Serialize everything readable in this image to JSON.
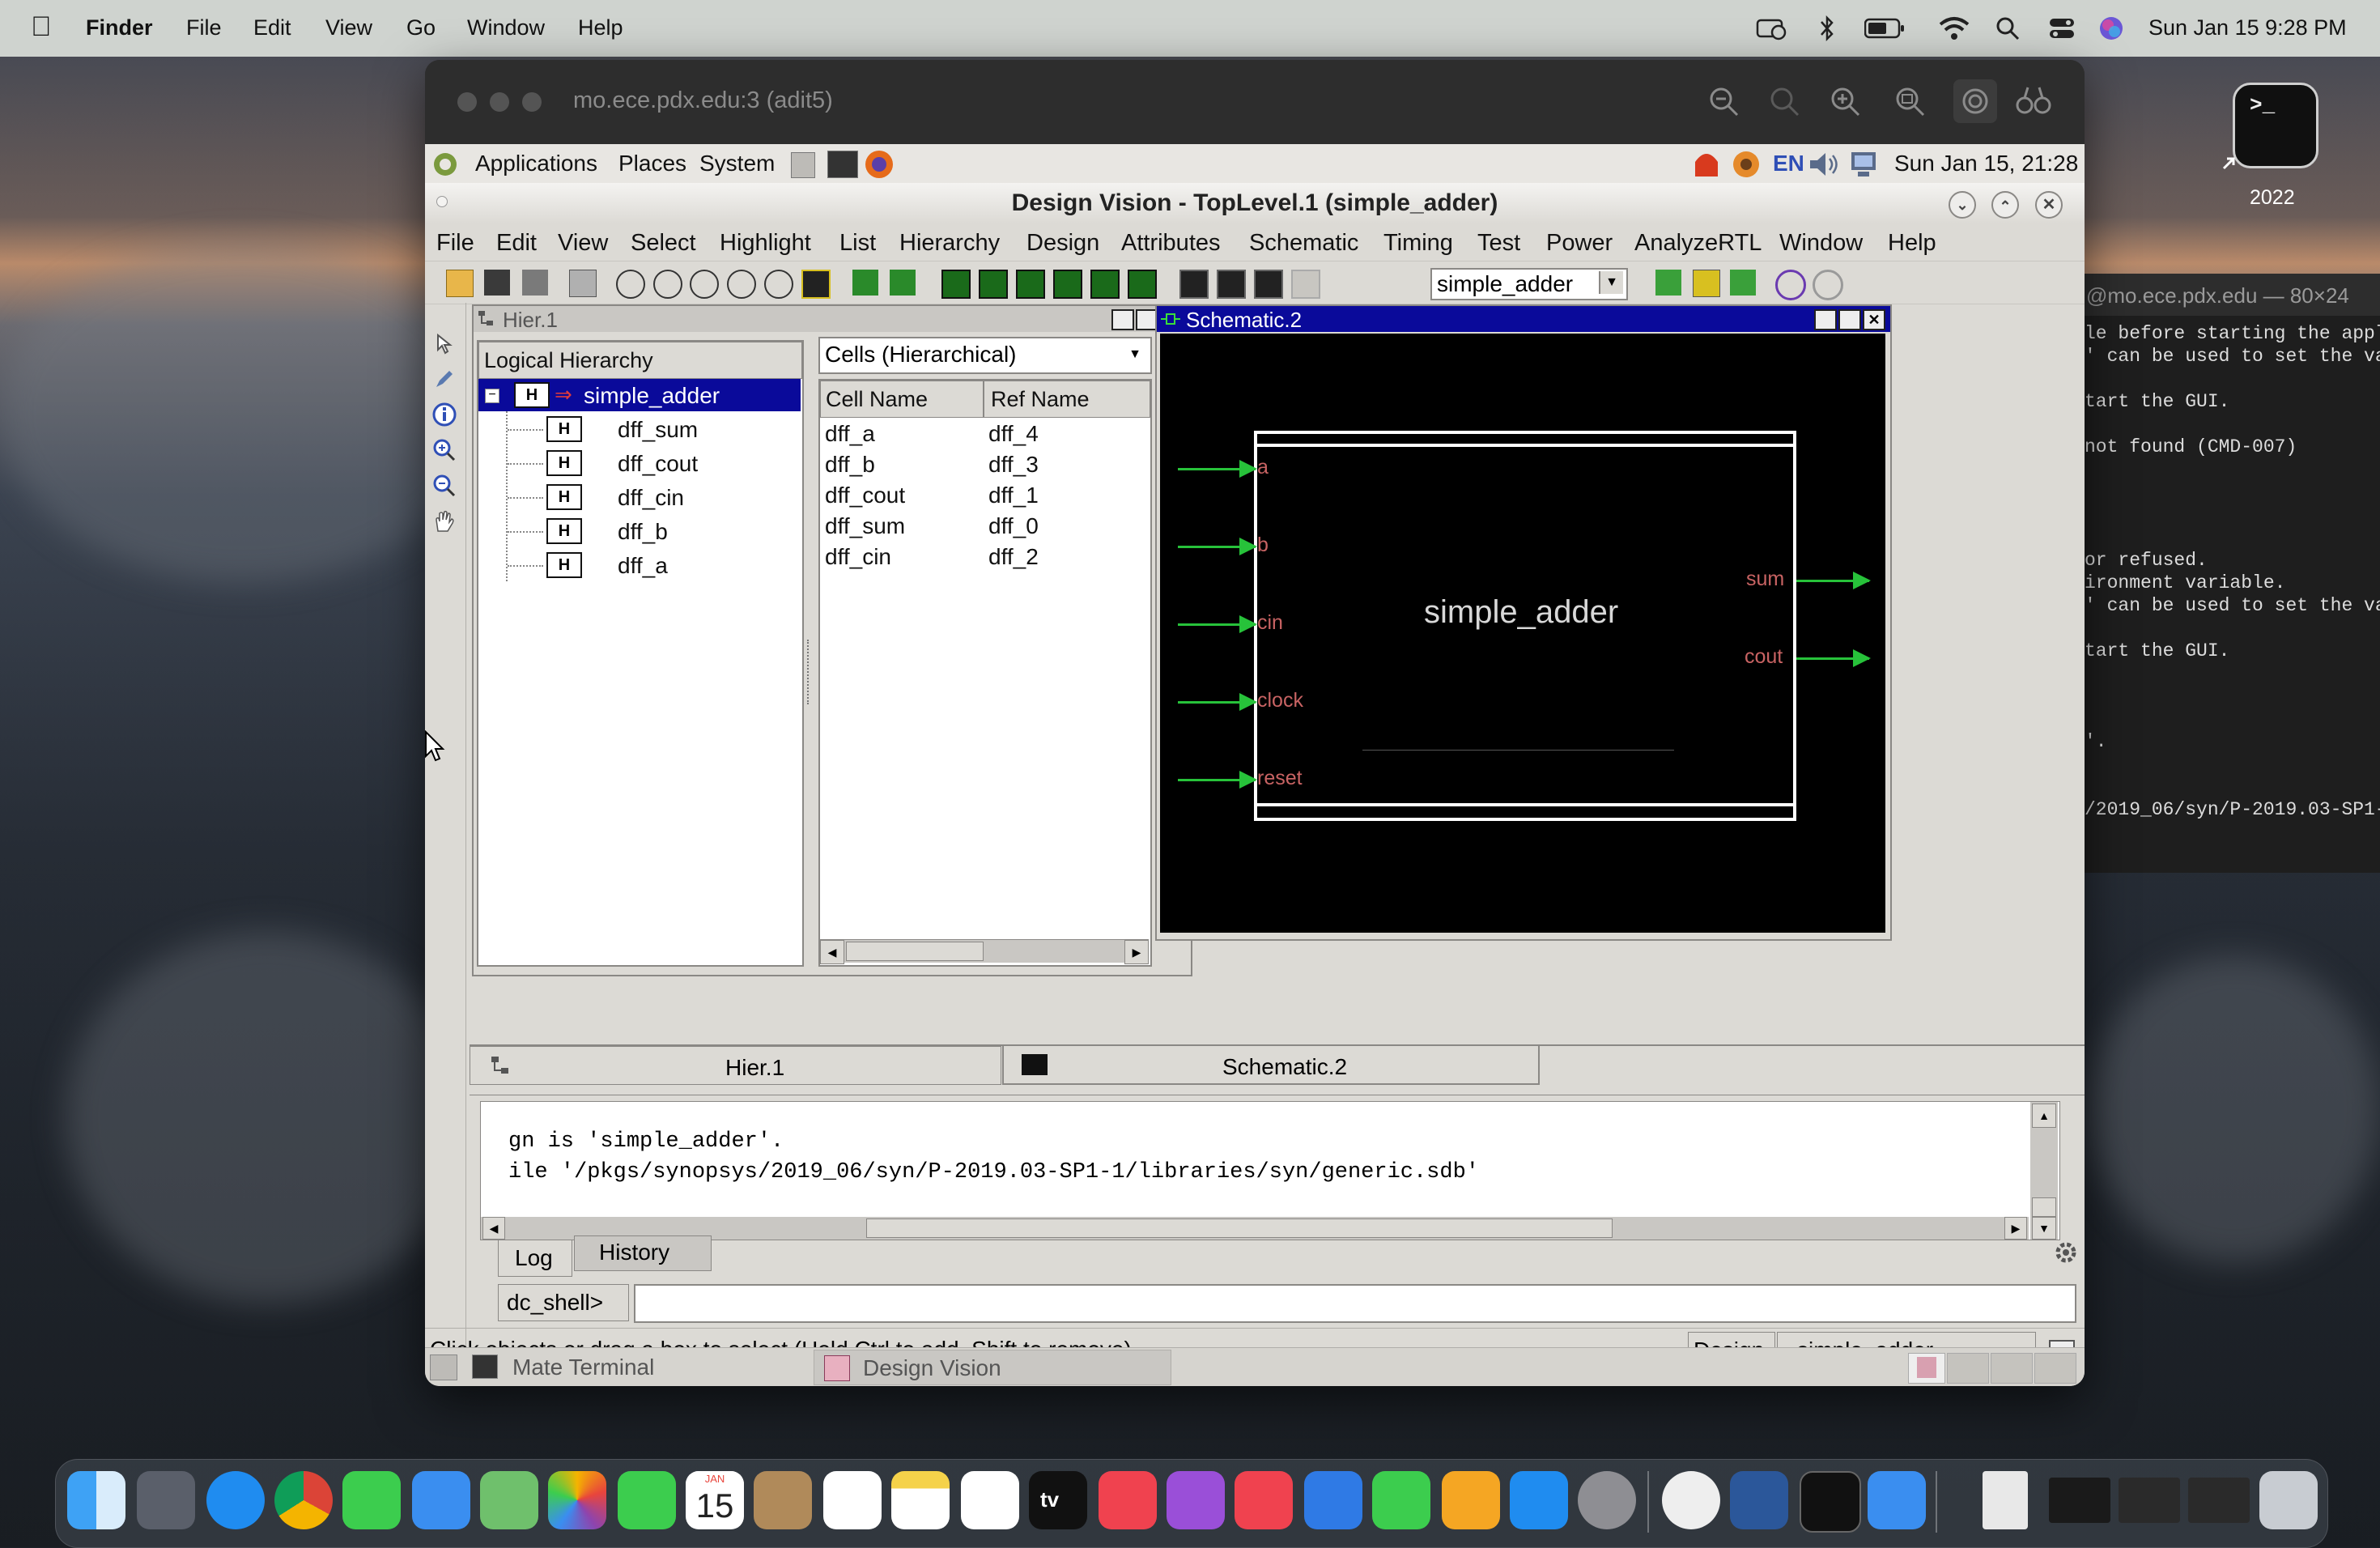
{
  "macos_menubar": {
    "app": "Finder",
    "menus": [
      "File",
      "Edit",
      "View",
      "Go",
      "Window",
      "Help"
    ],
    "clock": "Sun Jan 15  9:28 PM"
  },
  "desktop": {
    "terminal_icon_label": "2022",
    "terminal_prompt": ">_"
  },
  "remote_window": {
    "title": "mo.ece.pdx.edu:3 (adit5)"
  },
  "gnome_panel": {
    "menus": [
      "Applications",
      "Places",
      "System"
    ],
    "language": "EN",
    "clock": "Sun Jan 15, 21:28"
  },
  "design_vision": {
    "title": "Design Vision - TopLevel.1 (simple_adder)",
    "menus": [
      "File",
      "Edit",
      "View",
      "Select",
      "Highlight",
      "List",
      "Hierarchy",
      "Design",
      "Attributes",
      "Schematic",
      "Timing",
      "Test",
      "Power",
      "AnalyzeRTL",
      "Window",
      "Help"
    ],
    "design_select": "simple_adder",
    "hier_window": {
      "title": "Hier.1",
      "tree_header": "Logical Hierarchy",
      "root": "simple_adder",
      "children": [
        "dff_sum",
        "dff_cout",
        "dff_cin",
        "dff_b",
        "dff_a"
      ],
      "cells_dropdown": "Cells (Hierarchical)",
      "columns": [
        "Cell Name",
        "Ref Name"
      ],
      "rows": [
        [
          "dff_a",
          "dff_4"
        ],
        [
          "dff_b",
          "dff_3"
        ],
        [
          "dff_cout",
          "dff_1"
        ],
        [
          "dff_sum",
          "dff_0"
        ],
        [
          "dff_cin",
          "dff_2"
        ]
      ]
    },
    "schematic_window": {
      "title": "Schematic.2",
      "block_name": "simple_adder",
      "inputs": [
        "a",
        "b",
        "cin",
        "clock",
        "reset"
      ],
      "outputs": [
        "sum",
        "cout"
      ]
    },
    "bottom_tabs": [
      "Hier.1",
      "Schematic.2"
    ],
    "log_lines": [
      "gn is 'simple_adder'.",
      "ile '/pkgs/synopsys/2019_06/syn/P-2019.03-SP1-1/libraries/syn/generic.sdb'"
    ],
    "console_tabs": [
      "Log",
      "History"
    ],
    "prompt": "dc_shell>",
    "status_text": "Click objects or drag a box to select (Hold Ctrl to add, Shift to remove)",
    "status_design_label": "Design",
    "status_design_value": "simple_adder"
  },
  "gnome_taskbar": [
    "Mate Terminal",
    "Design Vision"
  ],
  "terminal_sliver": {
    "title": "@mo.ece.pdx.edu — 80×24",
    "lines": [
      "le before starting the appl",
      "' can be used to set the va",
      "",
      "tart the GUI.",
      "",
      "not found (CMD-007)",
      "",
      "",
      "",
      "",
      "or refused.",
      "ironment variable.",
      "' can be used to set the va",
      "",
      "tart the GUI.",
      "",
      "",
      "",
      "'.",
      "",
      "",
      "/2019_06/syn/P-2019.03-SP1-"
    ]
  },
  "dock": {
    "date_icon_month": "JAN",
    "date_icon_day": "15",
    "tv_label": "tv"
  },
  "colors": {
    "schematic_bg": "#000000",
    "pin_label": "#c86363",
    "pin_arrow": "#27c23a",
    "selection": "#0a0a9a"
  }
}
